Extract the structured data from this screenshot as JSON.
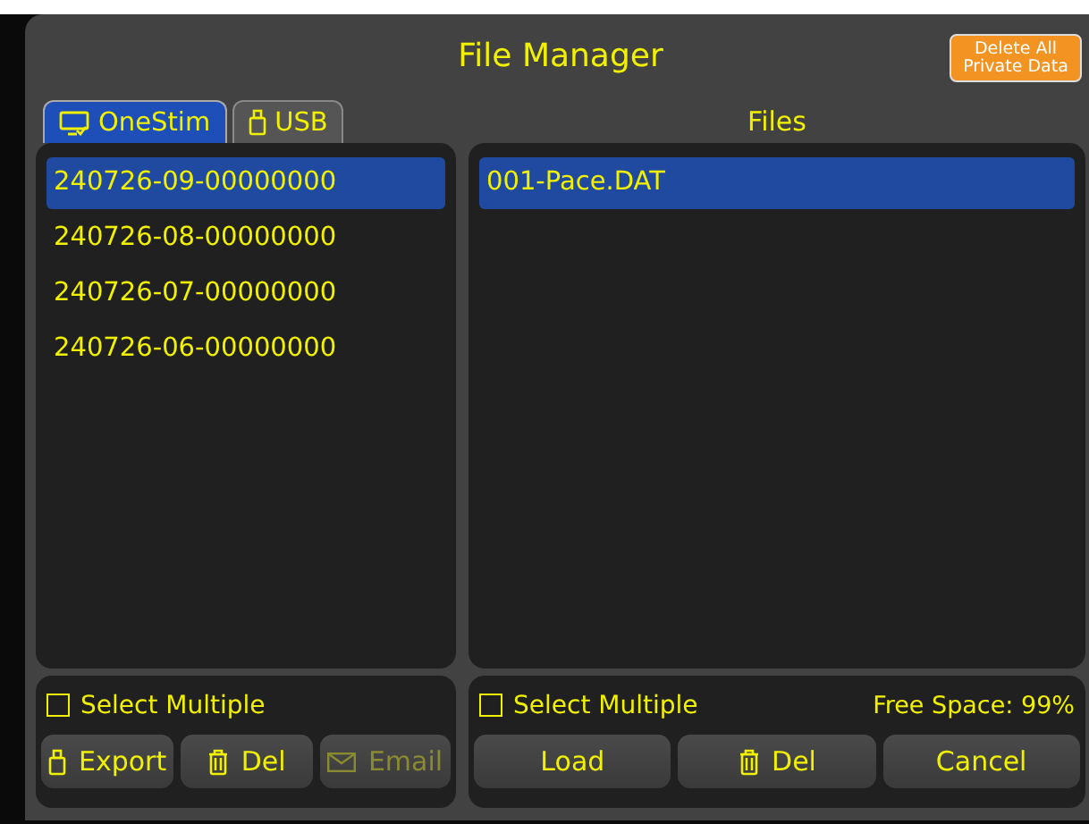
{
  "window": {
    "title": "File Manager"
  },
  "delete_all_button": {
    "label": "Delete All Private Data",
    "disabled": false
  },
  "tabs": [
    {
      "label": "OneStim",
      "kind": "device",
      "selected": true
    },
    {
      "label": "USB",
      "kind": "usb",
      "selected": false
    }
  ],
  "folders": {
    "items": [
      {
        "label": "240726-09-00000000",
        "selected": true
      },
      {
        "label": "240726-08-00000000",
        "selected": false
      },
      {
        "label": "240726-07-00000000",
        "selected": false
      },
      {
        "label": "240726-06-00000000",
        "selected": false
      }
    ],
    "select_multiple": {
      "label": "Select Multiple",
      "checked": false
    },
    "buttons": [
      {
        "label": "Export",
        "kind": "usb",
        "disabled": false
      },
      {
        "label": "Del",
        "kind": "trash",
        "disabled": false
      },
      {
        "label": "Email",
        "kind": "mail",
        "disabled": true
      }
    ]
  },
  "files": {
    "heading": "Files",
    "items": [
      {
        "label": "001-Pace.DAT",
        "selected": true
      }
    ],
    "select_multiple": {
      "label": "Select Multiple",
      "checked": false
    },
    "free_space": "Free Space: 99%",
    "buttons": [
      {
        "label": "Load",
        "kind": "text",
        "disabled": false
      },
      {
        "label": "Del",
        "kind": "trash",
        "disabled": false
      },
      {
        "label": "Cancel",
        "kind": "text",
        "disabled": false
      }
    ]
  }
}
